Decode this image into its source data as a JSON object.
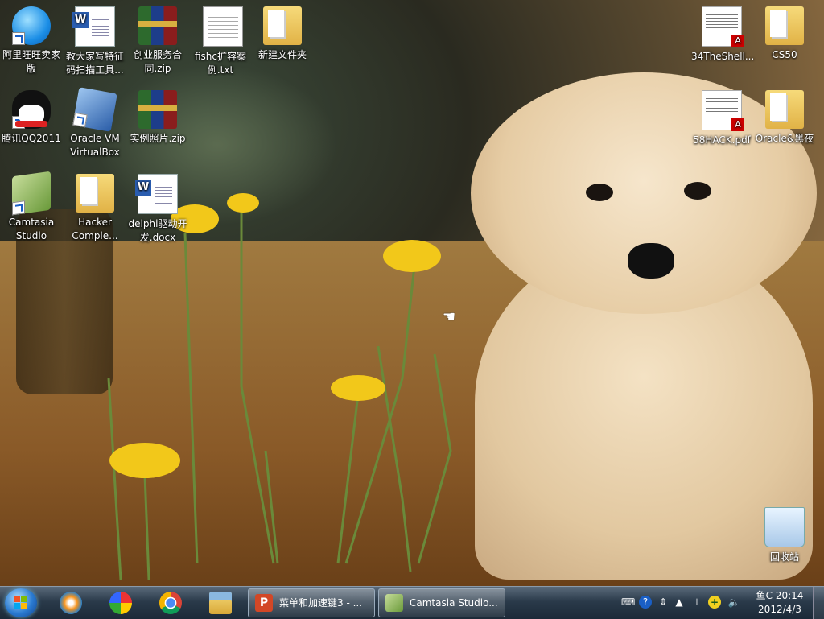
{
  "desktop": {
    "icons": [
      {
        "label": "阿里旺旺卖家版",
        "icon": "wangwang-icon"
      },
      {
        "label": "教大家写特征码扫描工具...",
        "icon": "word-doc-icon"
      },
      {
        "label": "创业服务合同.zip",
        "icon": "zip-archive-icon"
      },
      {
        "label": "fishc扩容案例.txt",
        "icon": "text-file-icon"
      },
      {
        "label": "新建文件夹",
        "icon": "folder-icon"
      },
      {
        "label": "腾讯QQ2011",
        "icon": "qq-icon"
      },
      {
        "label": "Oracle VM VirtualBox",
        "icon": "virtualbox-icon"
      },
      {
        "label": "实例照片.zip",
        "icon": "zip-archive-icon"
      },
      {
        "label": "Camtasia Studio",
        "icon": "camtasia-icon"
      },
      {
        "label": "Hacker Comple...",
        "icon": "folder-icon"
      },
      {
        "label": "delphi驱动开发.docx",
        "icon": "word-doc-icon"
      },
      {
        "label": "34TheShell...",
        "icon": "pdf-icon"
      },
      {
        "label": "CS50",
        "icon": "folder-icon"
      },
      {
        "label": "58HACK.pdf",
        "icon": "pdf-icon"
      },
      {
        "label": "Oracle&黑夜",
        "icon": "folder-icon"
      },
      {
        "label": "回收站",
        "icon": "recycle-bin-icon"
      }
    ],
    "wallpaper": "puppy-with-dandelions"
  },
  "taskbar": {
    "start": {
      "icon": "windows-start-icon"
    },
    "pinned": [
      {
        "icon": "windows-media-player-icon"
      },
      {
        "icon": "pinwheel-app-icon"
      },
      {
        "icon": "chrome-icon"
      },
      {
        "icon": "windows-explorer-icon"
      }
    ],
    "windows": [
      {
        "label": "菜单和加速键3 - ...",
        "icon": "powerpoint-icon"
      },
      {
        "label": "Camtasia Studio...",
        "icon": "camtasia-icon"
      }
    ],
    "tray": {
      "input_method": "鱼C",
      "time": "20:14",
      "date": "2012/4/3"
    }
  },
  "colors": {
    "taskbar_top": "#5a6a7a",
    "taskbar_bottom": "#1c2a38",
    "icon_text": "#ffffff",
    "dandelion": "#f2c81a"
  }
}
